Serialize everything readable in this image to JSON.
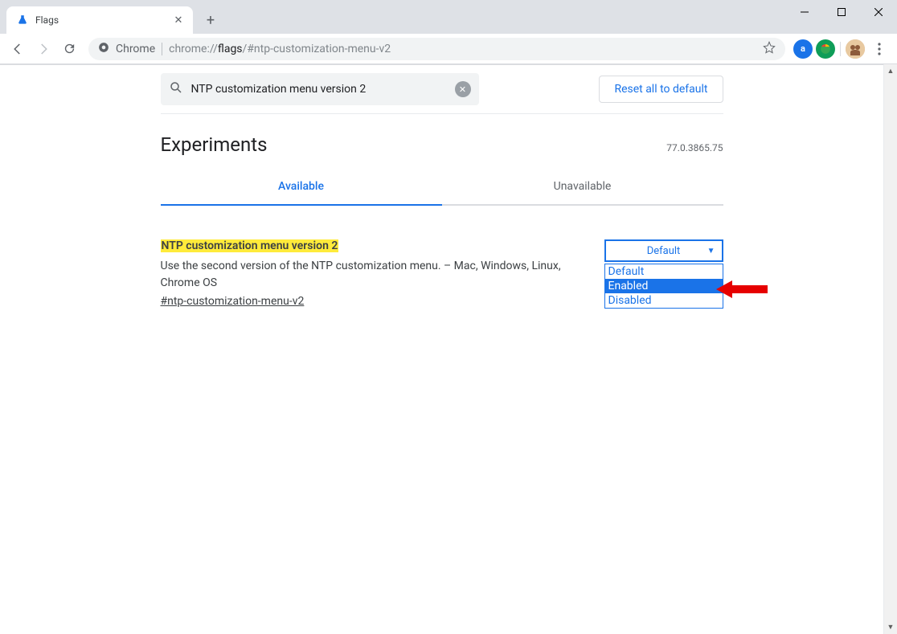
{
  "window": {
    "tab_title": "Flags",
    "url_prefix": "Chrome",
    "url_host_seg1": "chrome://",
    "url_host_seg2": "flags",
    "url_path": "/#ntp-customization-menu-v2"
  },
  "toolbar": {
    "back": "←",
    "forward": "→",
    "reload": "↻"
  },
  "extensions": {
    "a_label": "a",
    "b_label": "◉"
  },
  "page": {
    "search_value": "NTP customization menu version 2",
    "reset_label": "Reset all to default",
    "title": "Experiments",
    "version": "77.0.3865.75",
    "tab_available": "Available",
    "tab_unavailable": "Unavailable"
  },
  "flag": {
    "title": "NTP customization menu version 2",
    "desc": "Use the second version of the NTP customization menu. – Mac, Windows, Linux, Chrome OS",
    "anchor": "#ntp-customization-menu-v2",
    "selected": "Default",
    "options": {
      "default": "Default",
      "enabled": "Enabled",
      "disabled": "Disabled"
    }
  }
}
